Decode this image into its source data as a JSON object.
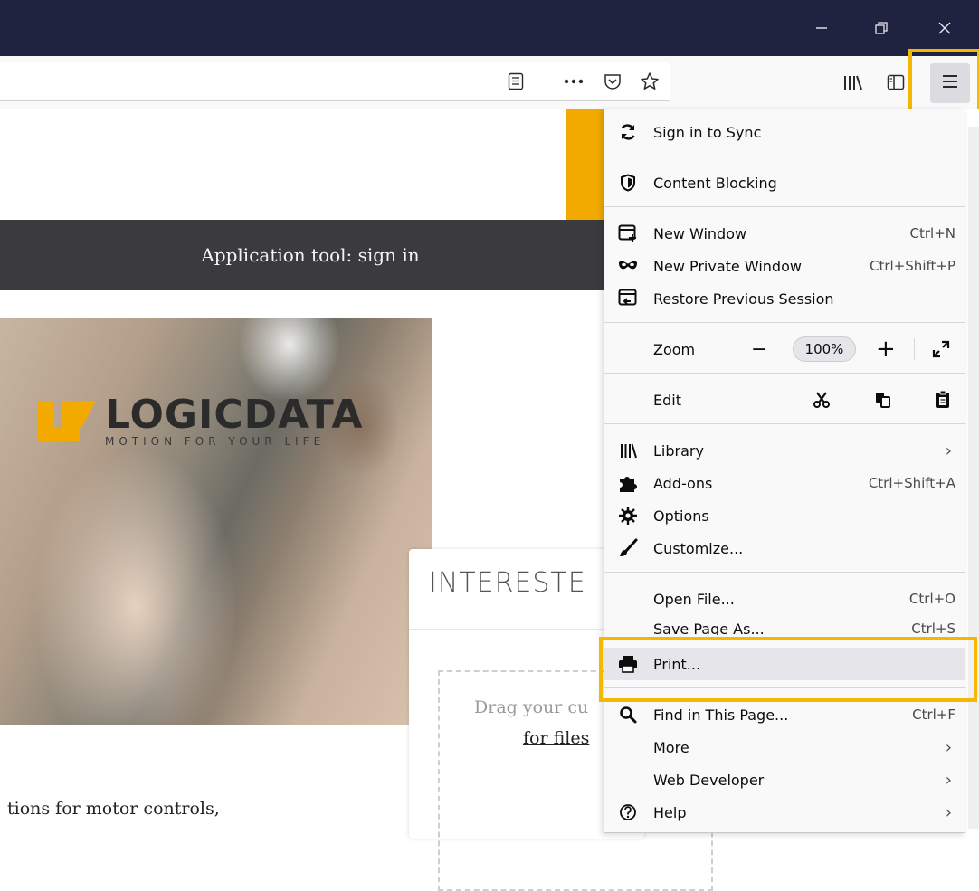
{
  "window": {
    "controls": [
      "minimize-icon",
      "restore-icon",
      "close-icon"
    ]
  },
  "toolbar": {
    "icons": [
      "reader-view-icon",
      "page-actions-icon",
      "pocket-icon",
      "bookmark-star-icon",
      "library-icon",
      "sidebar-icon",
      "hamburger-menu-icon"
    ]
  },
  "page": {
    "signin_band": "Application tool: sign in",
    "logo": {
      "name": "LOGICDATA",
      "tagline": "MOTION FOR YOUR LIFE"
    },
    "card_title": "INTERESTE",
    "drag_text": "Drag your cu",
    "files_link": "for files",
    "bottom_text": "tions for motor controls,"
  },
  "menu": {
    "sign_in": "Sign in to Sync",
    "content_blocking": "Content Blocking",
    "new_window": {
      "label": "New Window",
      "shortcut": "Ctrl+N"
    },
    "new_private": {
      "label": "New Private Window",
      "shortcut": "Ctrl+Shift+P"
    },
    "restore_session": "Restore Previous Session",
    "zoom": {
      "label": "Zoom",
      "minus": "−",
      "value": "100%",
      "plus": "+"
    },
    "edit": "Edit",
    "library": "Library",
    "addons": {
      "label": "Add-ons",
      "shortcut": "Ctrl+Shift+A"
    },
    "options": "Options",
    "customize": "Customize...",
    "open_file": {
      "label": "Open File...",
      "shortcut": "Ctrl+O"
    },
    "save_page": {
      "label": "Save Page As...",
      "shortcut": "Ctrl+S"
    },
    "print": "Print...",
    "find": {
      "label": "Find in This Page...",
      "shortcut": "Ctrl+F"
    },
    "more": "More",
    "web_developer": "Web Developer",
    "help": "Help",
    "chevron": "›"
  },
  "colors": {
    "titlebar": "#202340",
    "highlight": "#f5b800",
    "orange": "#f2a900",
    "band": "#3b3b3d"
  }
}
